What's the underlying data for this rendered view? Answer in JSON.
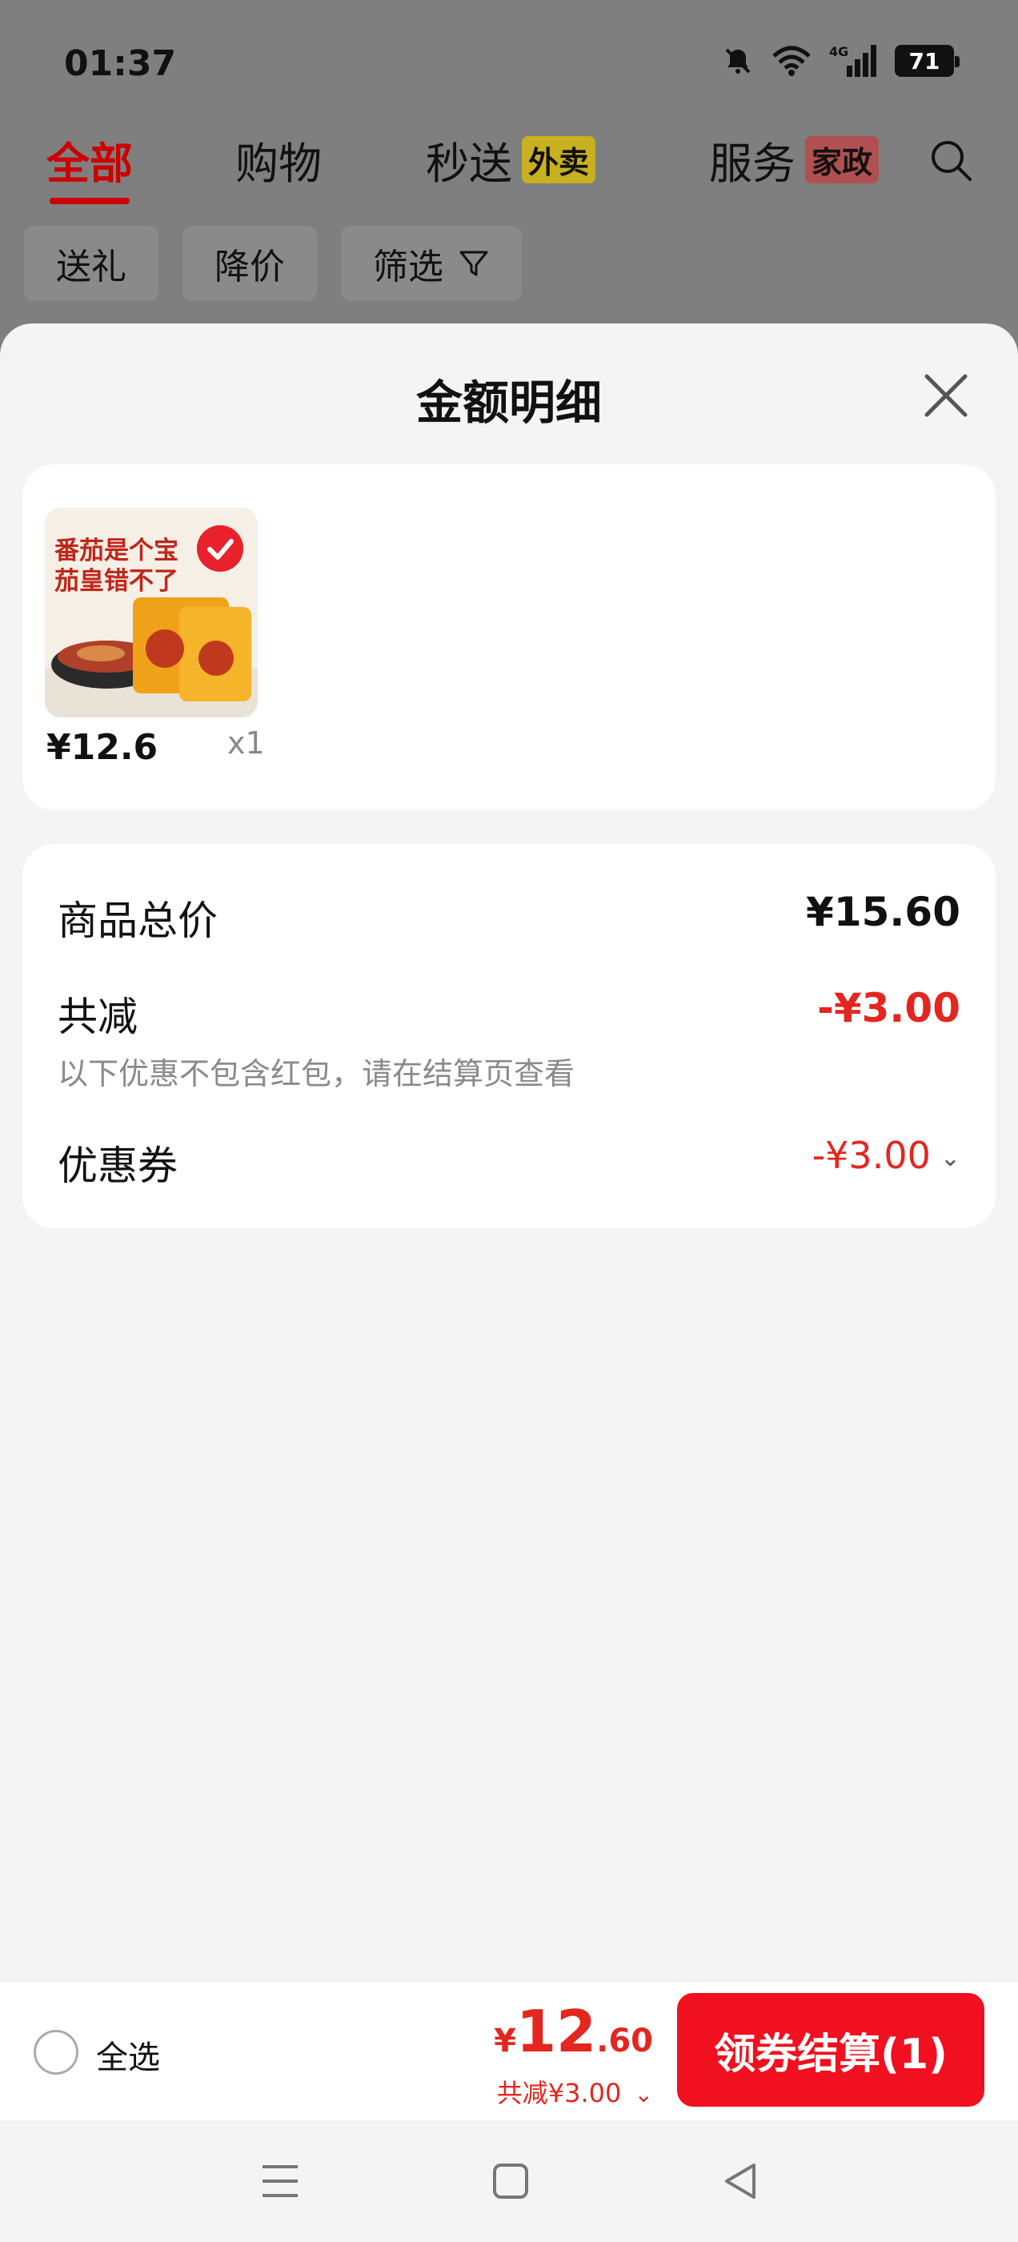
{
  "status_bar": {
    "time": "01:37",
    "network": "4G",
    "battery": "71"
  },
  "top_tabs": [
    {
      "label": "全部",
      "active": true
    },
    {
      "label": "购物",
      "active": false
    },
    {
      "label": "秒送",
      "badge": "外卖",
      "active": false
    },
    {
      "label": "服务",
      "badge": "家政",
      "active": false
    }
  ],
  "filters": [
    "送礼",
    "降价",
    "筛选"
  ],
  "sheet": {
    "title": "金额明细",
    "item": {
      "thumb_line1": "番茄是个宝",
      "thumb_line2": "茄皇错不了",
      "price": "¥12.6",
      "qty": "x1"
    },
    "summary": {
      "subtotal_label": "商品总价",
      "subtotal_value": "¥15.60",
      "discount_label": "共减",
      "discount_value": "-¥3.00",
      "note": "以下优惠不包含红包，请在结算页查看",
      "coupon_label": "优惠券",
      "coupon_value": "-¥3.00"
    }
  },
  "bottom_bar": {
    "select_all": "全选",
    "currency": "¥",
    "total_int": "12",
    "total_dec": ".60",
    "saving": "共减¥3.00",
    "checkout": "领券结算(1)"
  },
  "colors": {
    "accent": "#e3261f",
    "checkout_bg": "#f0101f"
  }
}
